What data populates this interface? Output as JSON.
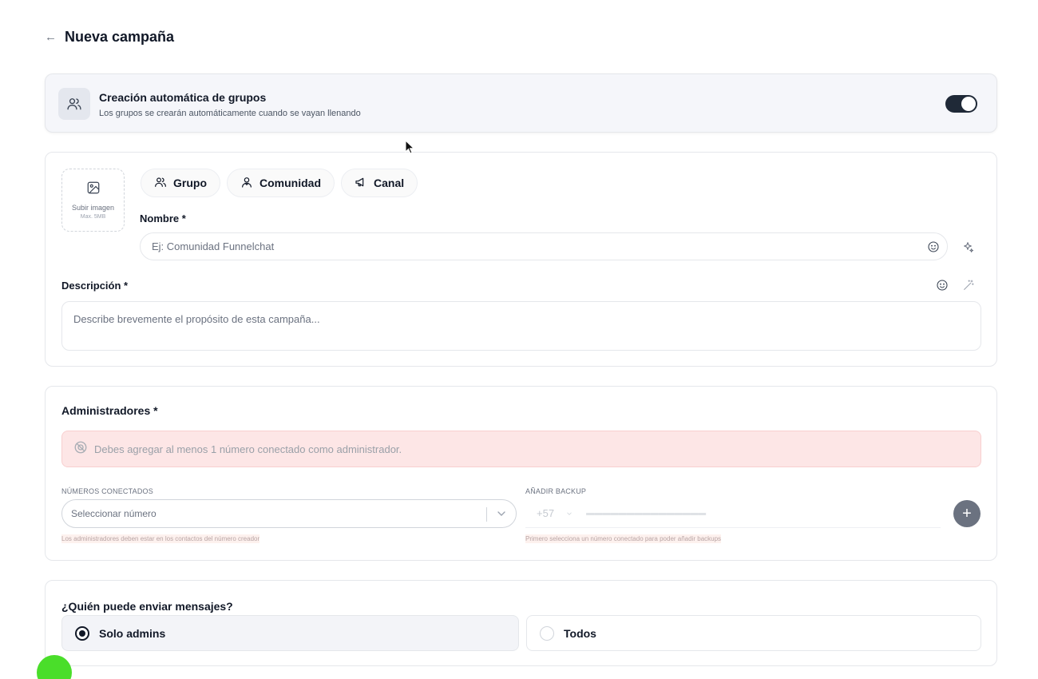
{
  "header": {
    "title": "Nueva campaña",
    "back_icon": "arrow-left-icon"
  },
  "auto_groups": {
    "title": "Creación automática de grupos",
    "subtitle": "Los grupos se crearán automáticamente cuando se vayan llenando",
    "enabled": true,
    "icon": "users-icon"
  },
  "identity": {
    "upload": {
      "label": "Subir imagen",
      "max": "Max. 5MB",
      "icon": "image-icon"
    },
    "types": [
      {
        "label": "Grupo",
        "icon": "users-icon"
      },
      {
        "label": "Comunidad",
        "icon": "community-icon"
      },
      {
        "label": "Canal",
        "icon": "megaphone-icon"
      }
    ],
    "name_label": "Nombre *",
    "name_placeholder": "Ej: Comunidad Funnelchat",
    "description_label": "Descripción *",
    "description_placeholder": "Describe brevemente el propósito de esta campaña..."
  },
  "admins": {
    "title": "Administradores *",
    "alert": "Debes agregar al menos 1 número conectado como administrador.",
    "connected_label": "NÚMEROS CONECTADOS",
    "select_placeholder": "Seleccionar número",
    "connected_hint": "Los administradores deben estar en los contactos del número creador",
    "backup_label": "AÑADIR BACKUP",
    "country_code": "+57",
    "backup_hint": "Primero selecciona un número conectado para poder añadir backups",
    "add_label": "+"
  },
  "messaging": {
    "title": "¿Quién puede enviar mensajes?",
    "options": [
      {
        "label": "Solo admins",
        "selected": true
      },
      {
        "label": "Todos",
        "selected": false
      }
    ]
  }
}
